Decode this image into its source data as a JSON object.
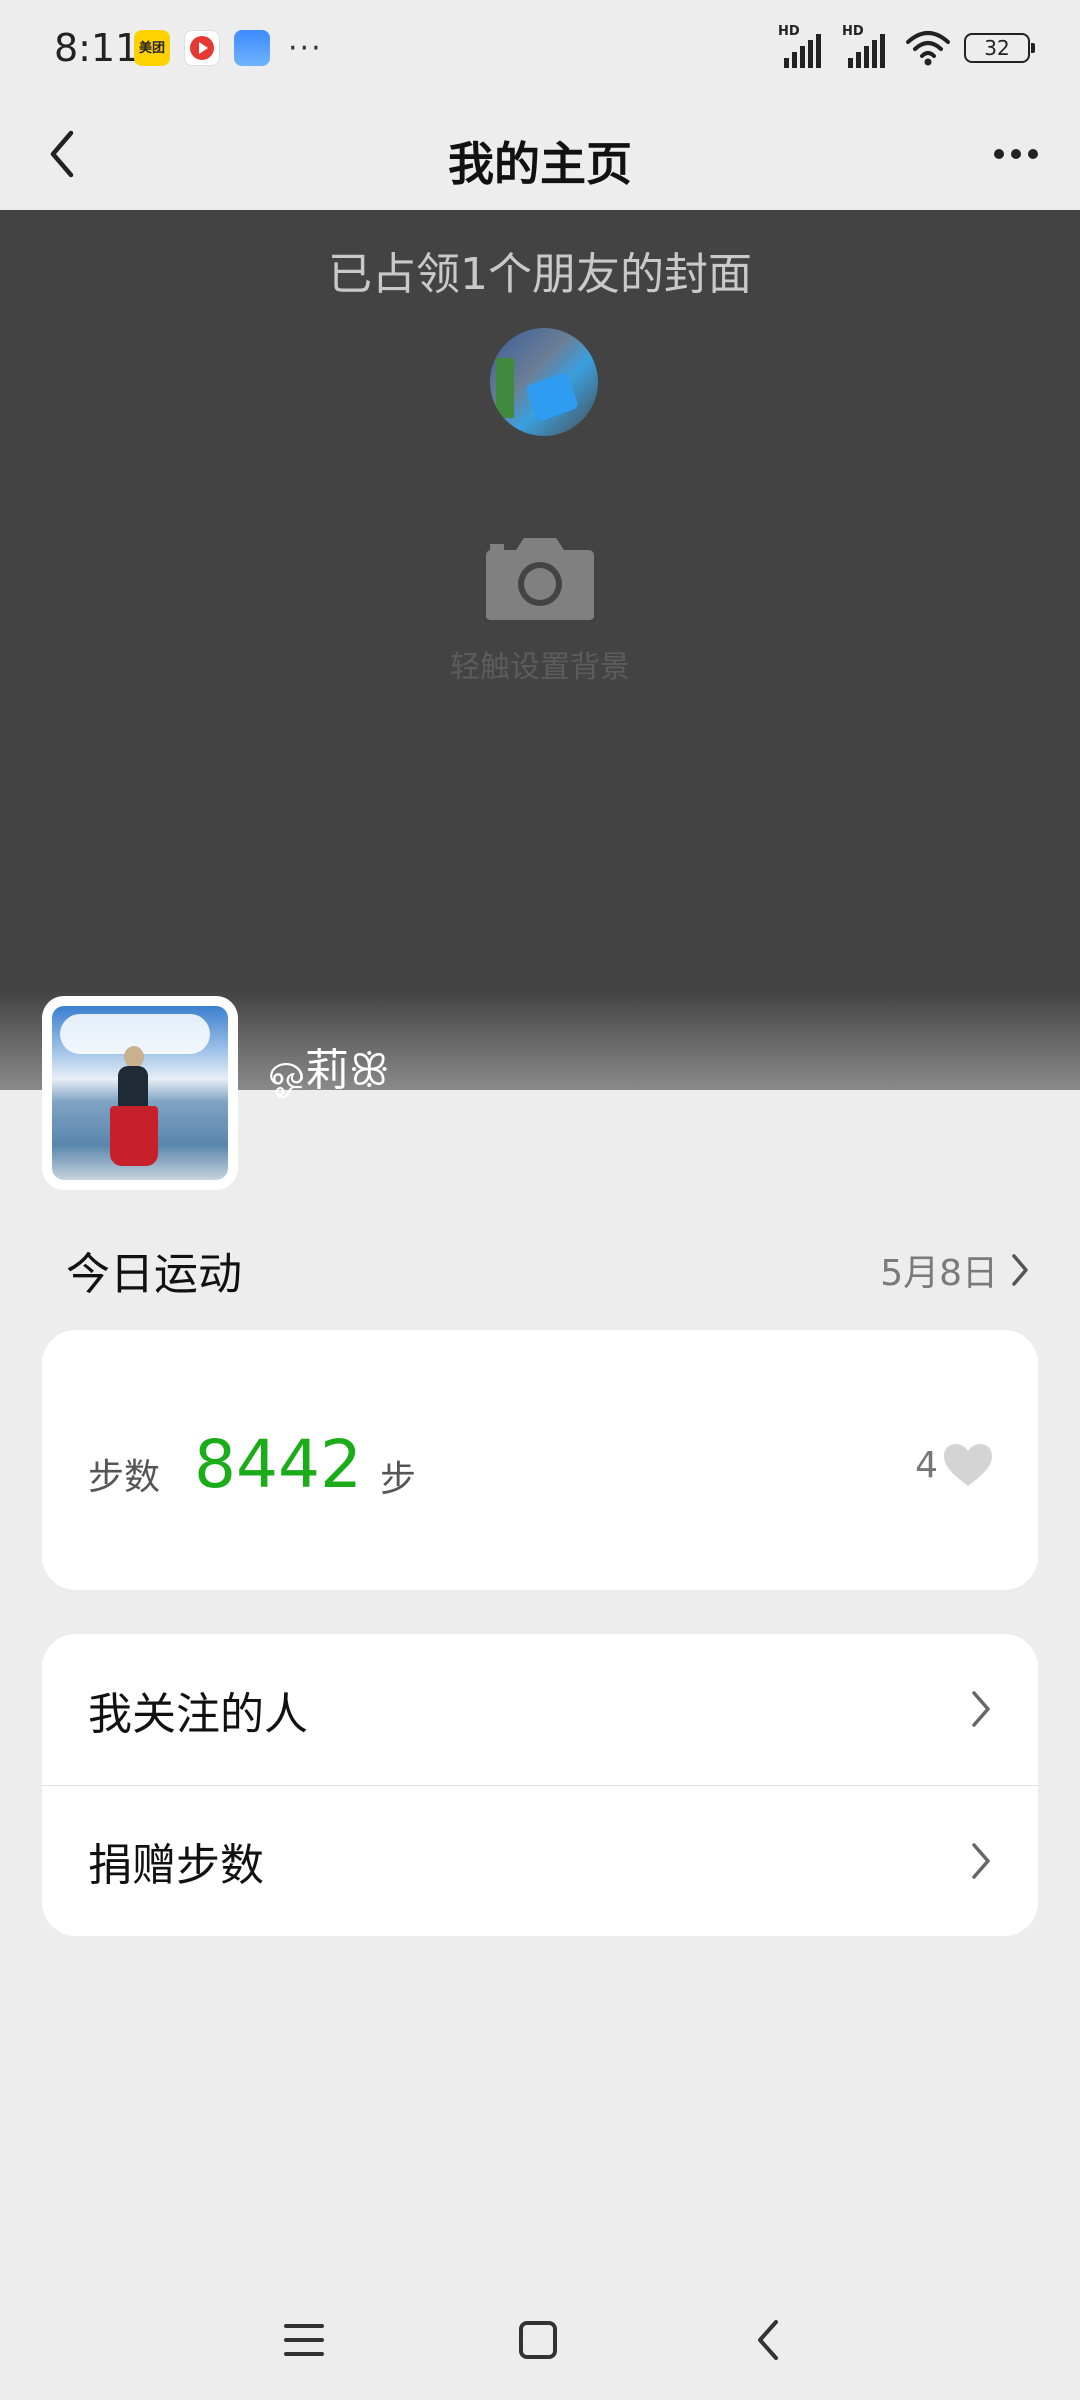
{
  "status_bar": {
    "time": "8:11",
    "notifications": [
      {
        "icon": "meituan-app-icon",
        "label": "美团"
      },
      {
        "icon": "video-app-icon"
      },
      {
        "icon": "cloud-app-icon"
      }
    ],
    "more": "···",
    "signal_labels": [
      "HD",
      "HD"
    ],
    "battery": "32"
  },
  "header": {
    "title": "我的主页"
  },
  "cover": {
    "occupied_text": "已占领1个朋友的封面",
    "hint": "轻触设置背景"
  },
  "profile": {
    "nickname": "ஓ莉ꕥ"
  },
  "today": {
    "title": "今日运动",
    "date": "5月8日",
    "steps_label": "步数",
    "steps_value": "8442",
    "steps_unit": "步",
    "likes": "4"
  },
  "menu": {
    "items": [
      {
        "label": "我关注的人"
      },
      {
        "label": "捐赠步数"
      }
    ]
  },
  "colors": {
    "accent_green": "#1aad19",
    "cover_bg": "#434343",
    "page_bg": "#ededed"
  }
}
